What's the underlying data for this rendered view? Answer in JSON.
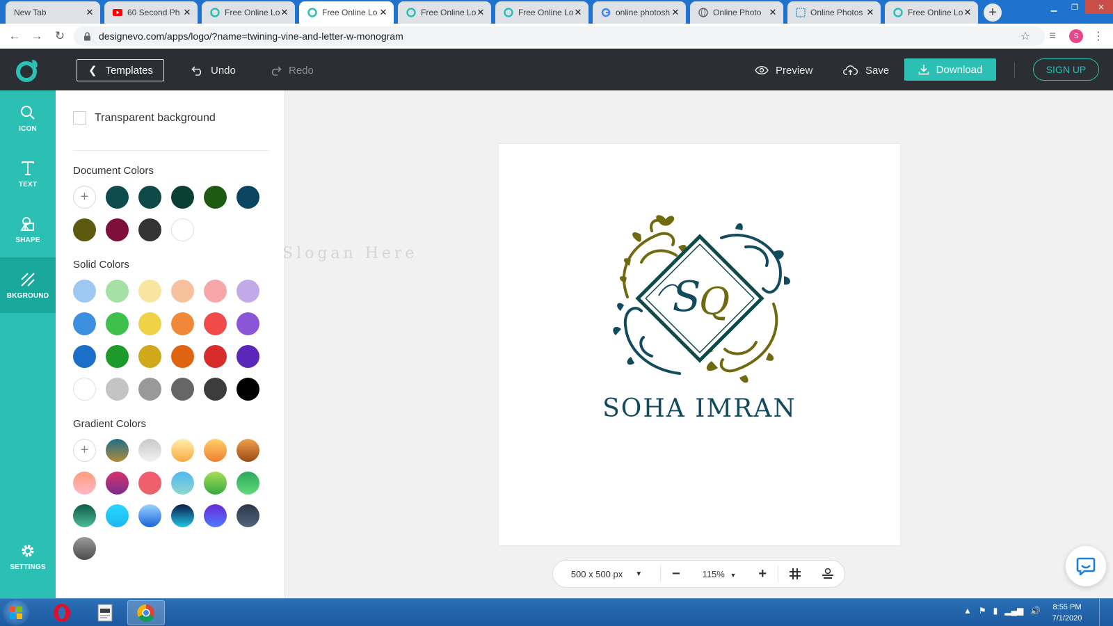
{
  "browser": {
    "tabs": [
      {
        "label": "New Tab",
        "favicon": "none"
      },
      {
        "label": "60 Second Ph",
        "favicon": "youtube-icon"
      },
      {
        "label": "Free Online Lo",
        "favicon": "designevo-icon"
      },
      {
        "label": "Free Online Lo",
        "favicon": "designevo-icon"
      },
      {
        "label": "Free Online Lo",
        "favicon": "designevo-icon"
      },
      {
        "label": "Free Online Lo",
        "favicon": "designevo-icon"
      },
      {
        "label": "online photosh",
        "favicon": "google-icon"
      },
      {
        "label": "Online Photo",
        "favicon": "globe-icon"
      },
      {
        "label": "Online Photos",
        "favicon": "grid-icon"
      },
      {
        "label": "Free Online Lo",
        "favicon": "designevo-icon"
      }
    ],
    "active_tab_index": 3,
    "url": "designevo.com/apps/logo/?name=twining-vine-and-letter-w-monogram",
    "profile_initial": "S"
  },
  "header": {
    "templates_label": "Templates",
    "undo_label": "Undo",
    "redo_label": "Redo",
    "preview_label": "Preview",
    "save_label": "Save",
    "download_label": "Download",
    "signup_label": "SIGN UP",
    "accent_color": "#2bc0b3"
  },
  "rail": {
    "items": [
      {
        "label": "ICON",
        "icon": "search-icon"
      },
      {
        "label": "TEXT",
        "icon": "text-icon"
      },
      {
        "label": "SHAPE",
        "icon": "shape-icon"
      },
      {
        "label": "BKGROUND",
        "icon": "background-icon",
        "active": true
      },
      {
        "label": "SETTINGS",
        "icon": "gear-icon"
      }
    ]
  },
  "panel": {
    "transparent_label": "Transparent background",
    "document_title": "Document Colors",
    "solid_title": "Solid Colors",
    "gradient_title": "Gradient Colors",
    "document_colors": [
      "#0d4b4f",
      "#0f4a48",
      "#0a3f36",
      "#1f5a13",
      "#0c4560",
      "#5b5a0f",
      "#7d0f3a",
      "#333333",
      "#ffffff"
    ],
    "solid_colors": [
      "#9ec8f2",
      "#a5e0a5",
      "#f9e4a0",
      "#f8c19d",
      "#f7a7a7",
      "#c2a9e8",
      "#3d8fe0",
      "#3fc04d",
      "#f0d247",
      "#f0883a",
      "#f04a4a",
      "#8a55d6",
      "#1b6fc9",
      "#1e9a2a",
      "#cfa91a",
      "#df6411",
      "#d82b2b",
      "#5a27b8",
      "#ffffff",
      "#c4c4c4",
      "#999999",
      "#666666",
      "#3c3c3c",
      "#000000"
    ],
    "gradient_colors": [
      [
        "#1f6e8c",
        "#b08a3a"
      ],
      [
        "#c8c8c8",
        "#f2f2f2"
      ],
      [
        "#fff0a8",
        "#f7a944"
      ],
      [
        "#ffd066",
        "#f07f32"
      ],
      [
        "#f0a04a",
        "#9a4a16"
      ],
      [
        "#ff9c7d",
        "#fcb8c8"
      ],
      [
        "#d6336c",
        "#7b2d8e"
      ],
      [
        "#f45c6f",
        "#e8646a"
      ],
      [
        "#52b8f0",
        "#8dd7cf"
      ],
      [
        "#a6de57",
        "#35a83f"
      ],
      [
        "#2ca85d",
        "#63d97a"
      ],
      [
        "#0f5c49",
        "#4cbb96"
      ],
      [
        "#2bd8ff",
        "#1bb6f0"
      ],
      [
        "#9bd4ff",
        "#1a62d8"
      ],
      [
        "#0b1d4b",
        "#22c4e6"
      ],
      [
        "#6a2ad8",
        "#4f7aff"
      ],
      [
        "#2b3748",
        "#52657a"
      ],
      [
        "#9a9a9a",
        "#4d4d4d"
      ]
    ]
  },
  "canvas": {
    "slogan_placeholder": "Slogan Here",
    "brand_text": "SOHA IMRAN",
    "monogram_left": "S",
    "monogram_right": "Q",
    "colors": {
      "teal": "#124a5e",
      "olive": "#6f6a0f",
      "frame": "#0e4a48"
    }
  },
  "bottombar": {
    "size_label": "500 x 500 px",
    "zoom_label": "115%"
  },
  "taskbar": {
    "time": "8:55 PM",
    "date": "7/1/2020"
  }
}
